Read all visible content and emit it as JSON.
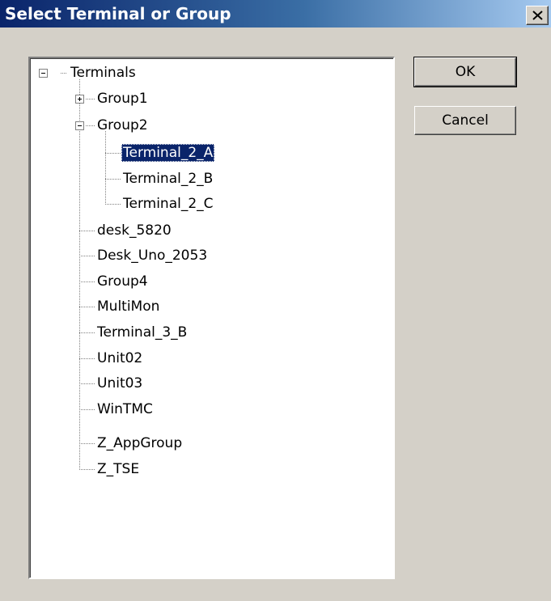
{
  "window": {
    "title": "Select Terminal or Group",
    "close_symbol": "✕"
  },
  "buttons": {
    "ok": "OK",
    "cancel": "Cancel"
  },
  "tree": {
    "root": "Terminals",
    "group1": "Group1",
    "group2": "Group2",
    "group2_children": [
      "Terminal_2_A",
      "Terminal_2_B",
      "Terminal_2_C"
    ],
    "items": [
      "desk_5820",
      "Desk_Uno_2053",
      "Group4",
      "MultiMon",
      "Terminal_3_B",
      "Unit02",
      "Unit03",
      "WinTMC",
      "Z_AppGroup",
      "Z_TSE"
    ],
    "selected": "Terminal_2_A"
  },
  "colors": {
    "selection": "#0a246a",
    "titlebar_start": "#0a246a",
    "titlebar_end": "#a6caf0",
    "face": "#d4d0c8"
  }
}
